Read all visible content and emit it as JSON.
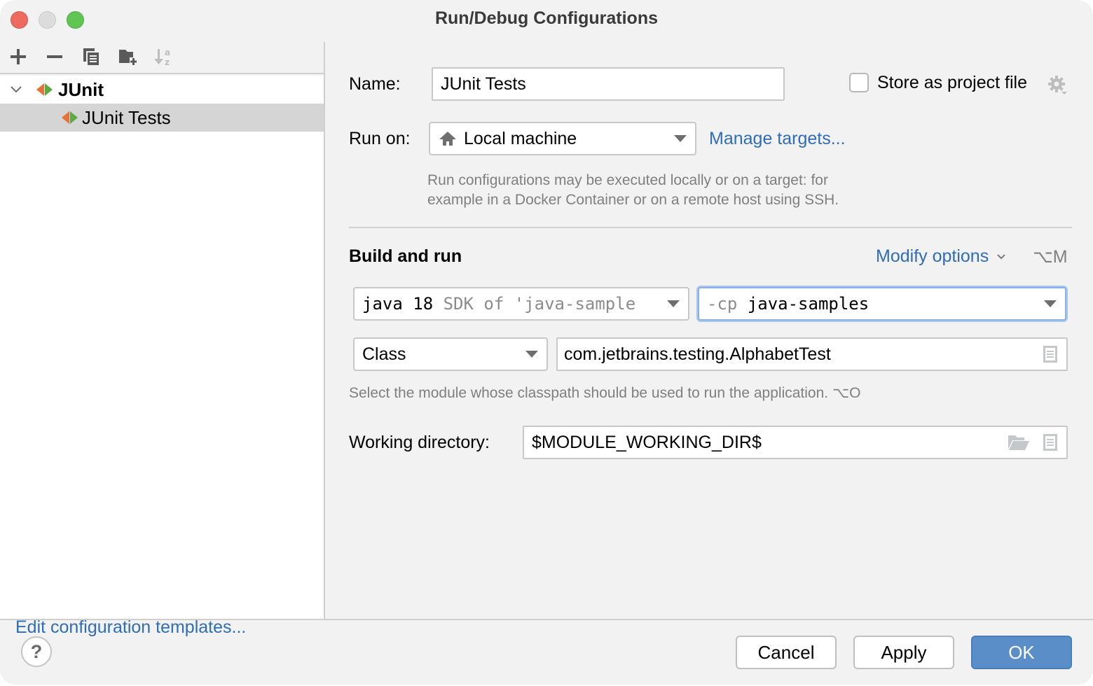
{
  "window": {
    "title": "Run/Debug Configurations"
  },
  "toolbar": {
    "add_icon": "plus-icon",
    "remove_icon": "minus-icon",
    "copy_icon": "copy-icon",
    "new_folder_icon": "folder-add-icon",
    "sort_icon": "sort-alphabetically-icon"
  },
  "tree": {
    "group": {
      "label": "JUnit",
      "expanded": true
    },
    "items": [
      {
        "label": "JUnit Tests",
        "selected": true
      }
    ]
  },
  "left_footer": {
    "edit_templates_label": "Edit configuration templates..."
  },
  "form": {
    "name_label": "Name:",
    "name_value": "JUnit Tests",
    "store_as_project_label": "Store as project file",
    "store_as_project_checked": false,
    "run_on_label": "Run on:",
    "run_on_value": "Local machine",
    "manage_targets_label": "Manage targets...",
    "run_on_hint_line1": "Run configurations may be executed locally or on a target: for",
    "run_on_hint_line2": "example in a Docker Container or on a remote host using SSH.",
    "build_run_title": "Build and run",
    "modify_options_label": "Modify options",
    "modify_options_shortcut": "⌥M",
    "jre_value_main": "java 18",
    "jre_value_hint": "SDK of 'java-sample",
    "cp_prefix": "-cp",
    "cp_value": "java-samples",
    "test_kind_value": "Class",
    "class_value": "com.jetbrains.testing.AlphabetTest",
    "module_hint": "Select the module whose classpath should be used to run the application. ⌥O",
    "working_dir_label": "Working directory:",
    "working_dir_value": "$MODULE_WORKING_DIR$"
  },
  "footer": {
    "help_label": "?",
    "cancel_label": "Cancel",
    "apply_label": "Apply",
    "ok_label": "OK"
  },
  "colors": {
    "accent": "#2f6db5",
    "primary_button": "#5a8ec8",
    "focus_ring": "#8cb2e3",
    "junit_left": "#e8703a",
    "junit_right": "#5aab47"
  }
}
